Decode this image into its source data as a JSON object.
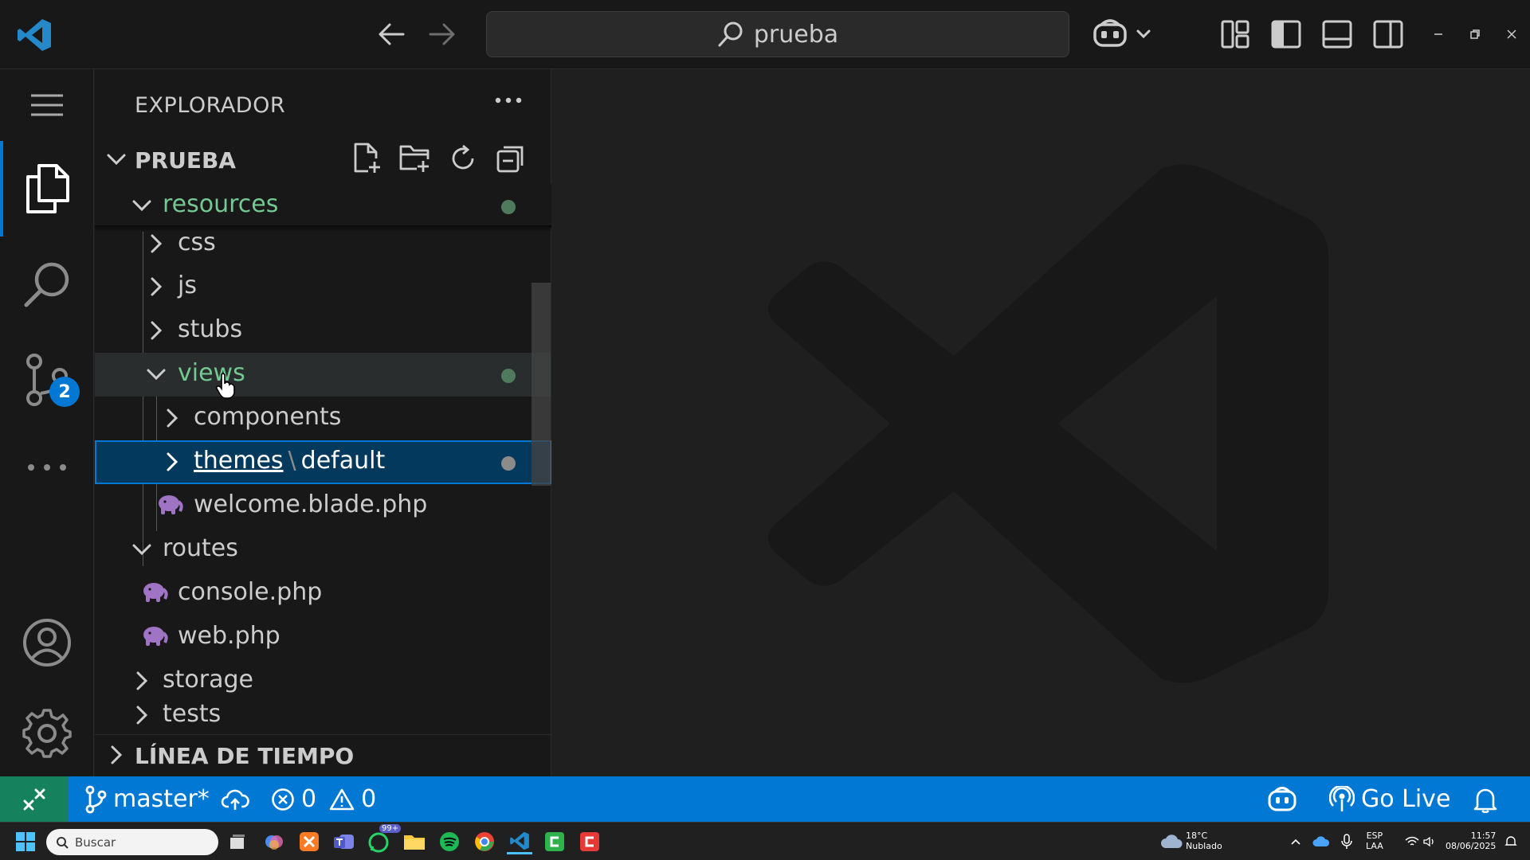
{
  "titlebar": {
    "search_text": "prueba"
  },
  "activity": {
    "scm_badge": "2"
  },
  "sidebar": {
    "title": "EXPLORADOR",
    "folder_name": "PRUEBA",
    "tree": {
      "resources": "resources",
      "css": "css",
      "js": "js",
      "stubs": "stubs",
      "views": "views",
      "components": "components",
      "themes": "themes",
      "themes_sep": "\\",
      "default": "default",
      "welcome": "welcome.blade.php",
      "routes": "routes",
      "console": "console.php",
      "web": "web.php",
      "storage": "storage",
      "tests": "tests"
    },
    "timeline": "LÍNEA DE TIEMPO"
  },
  "statusbar": {
    "branch": "master*",
    "errors": "0",
    "warnings": "0",
    "go_live": "Go Live"
  },
  "taskbar": {
    "search_placeholder": "Buscar",
    "weather_temp": "18°C",
    "weather_desc": "Nublado",
    "lang_1": "ESP",
    "lang_2": "LAA",
    "time": "11:57",
    "date": "08/06/2025",
    "whatsapp_badge": "99+"
  },
  "colors": {
    "accent": "#0078d4",
    "modified_green": "#73c991",
    "php_purple": "#a074c4",
    "remote_green": "#16825d"
  }
}
